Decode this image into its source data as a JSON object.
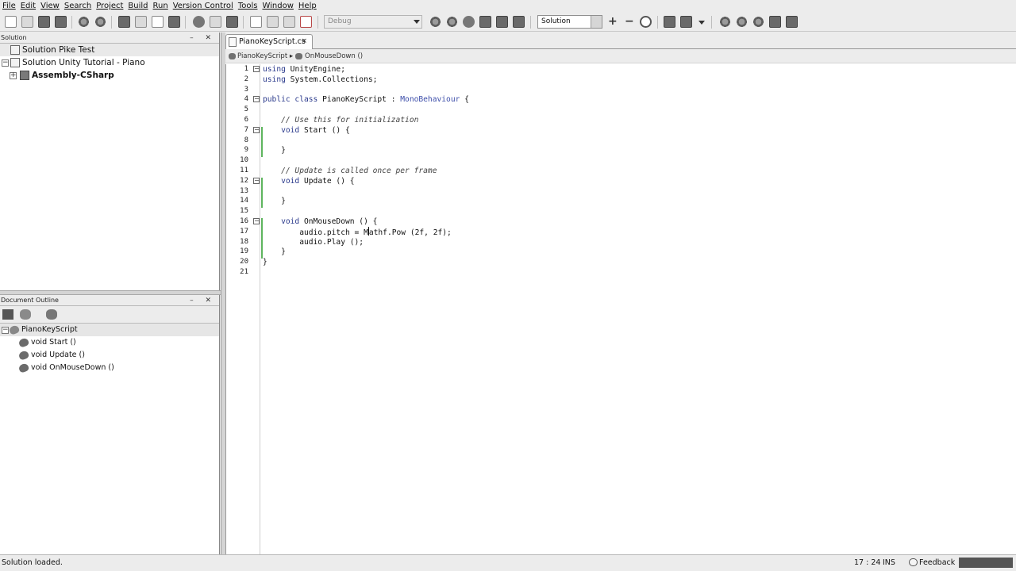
{
  "menu": [
    "File",
    "Edit",
    "View",
    "Search",
    "Project",
    "Build",
    "Run",
    "Version Control",
    "Tools",
    "Window",
    "Help"
  ],
  "toolbar": {
    "config": "Debug",
    "solution_combo": "Solution"
  },
  "solution_pad": {
    "title": "Solution",
    "controls": "– ✕",
    "items": [
      {
        "label": "Solution Pike Test"
      },
      {
        "label": "Solution Unity Tutorial - Piano"
      },
      {
        "label": "Assembly-CSharp"
      }
    ]
  },
  "outline_pad": {
    "title": "Document Outline",
    "controls": "– ✕",
    "class_name": "PianoKeyScript",
    "methods": [
      "void Start ()",
      "void Update ()",
      "void OnMouseDown ()"
    ]
  },
  "editor": {
    "tab_label": "PianoKeyScript.cs",
    "tab_close": "×",
    "path_class": "PianoKeyScript ▸",
    "path_method": "OnMouseDown ()",
    "line_numbers": [
      "1",
      "2",
      "3",
      "4",
      "5",
      "6",
      "7",
      "8",
      "9",
      "10",
      "11",
      "12",
      "13",
      "14",
      "15",
      "16",
      "17",
      "18",
      "19",
      "20",
      "21"
    ],
    "code": {
      "l1_kw": "using",
      "l1_rest": " UnityEngine;",
      "l2_kw": "using",
      "l2_rest": " System.Collections;",
      "l4_kw": "public class",
      "l4_name": " PianoKeyScript : ",
      "l4_base": "MonoBehaviour",
      "l4_end": " {",
      "l6": "    // Use this for initialization",
      "l7_kw": "    void",
      "l7_rest": " Start () {",
      "l9": "    }",
      "l11": "    // Update is called once per frame",
      "l12_kw": "    void",
      "l12_rest": " Update () {",
      "l14": "    }",
      "l16_kw": "    void",
      "l16_rest": " OnMouseDown () {",
      "l17_a": "        audio.pitch = M",
      "l17_b": "athf.Pow (2f, 2f);",
      "l18": "        audio.Play ();",
      "l19": "    }",
      "l20": "}"
    }
  },
  "status": {
    "text": "Solution loaded.",
    "position": "17 : 24",
    "mode": "INS",
    "feedback": "Feedback"
  }
}
